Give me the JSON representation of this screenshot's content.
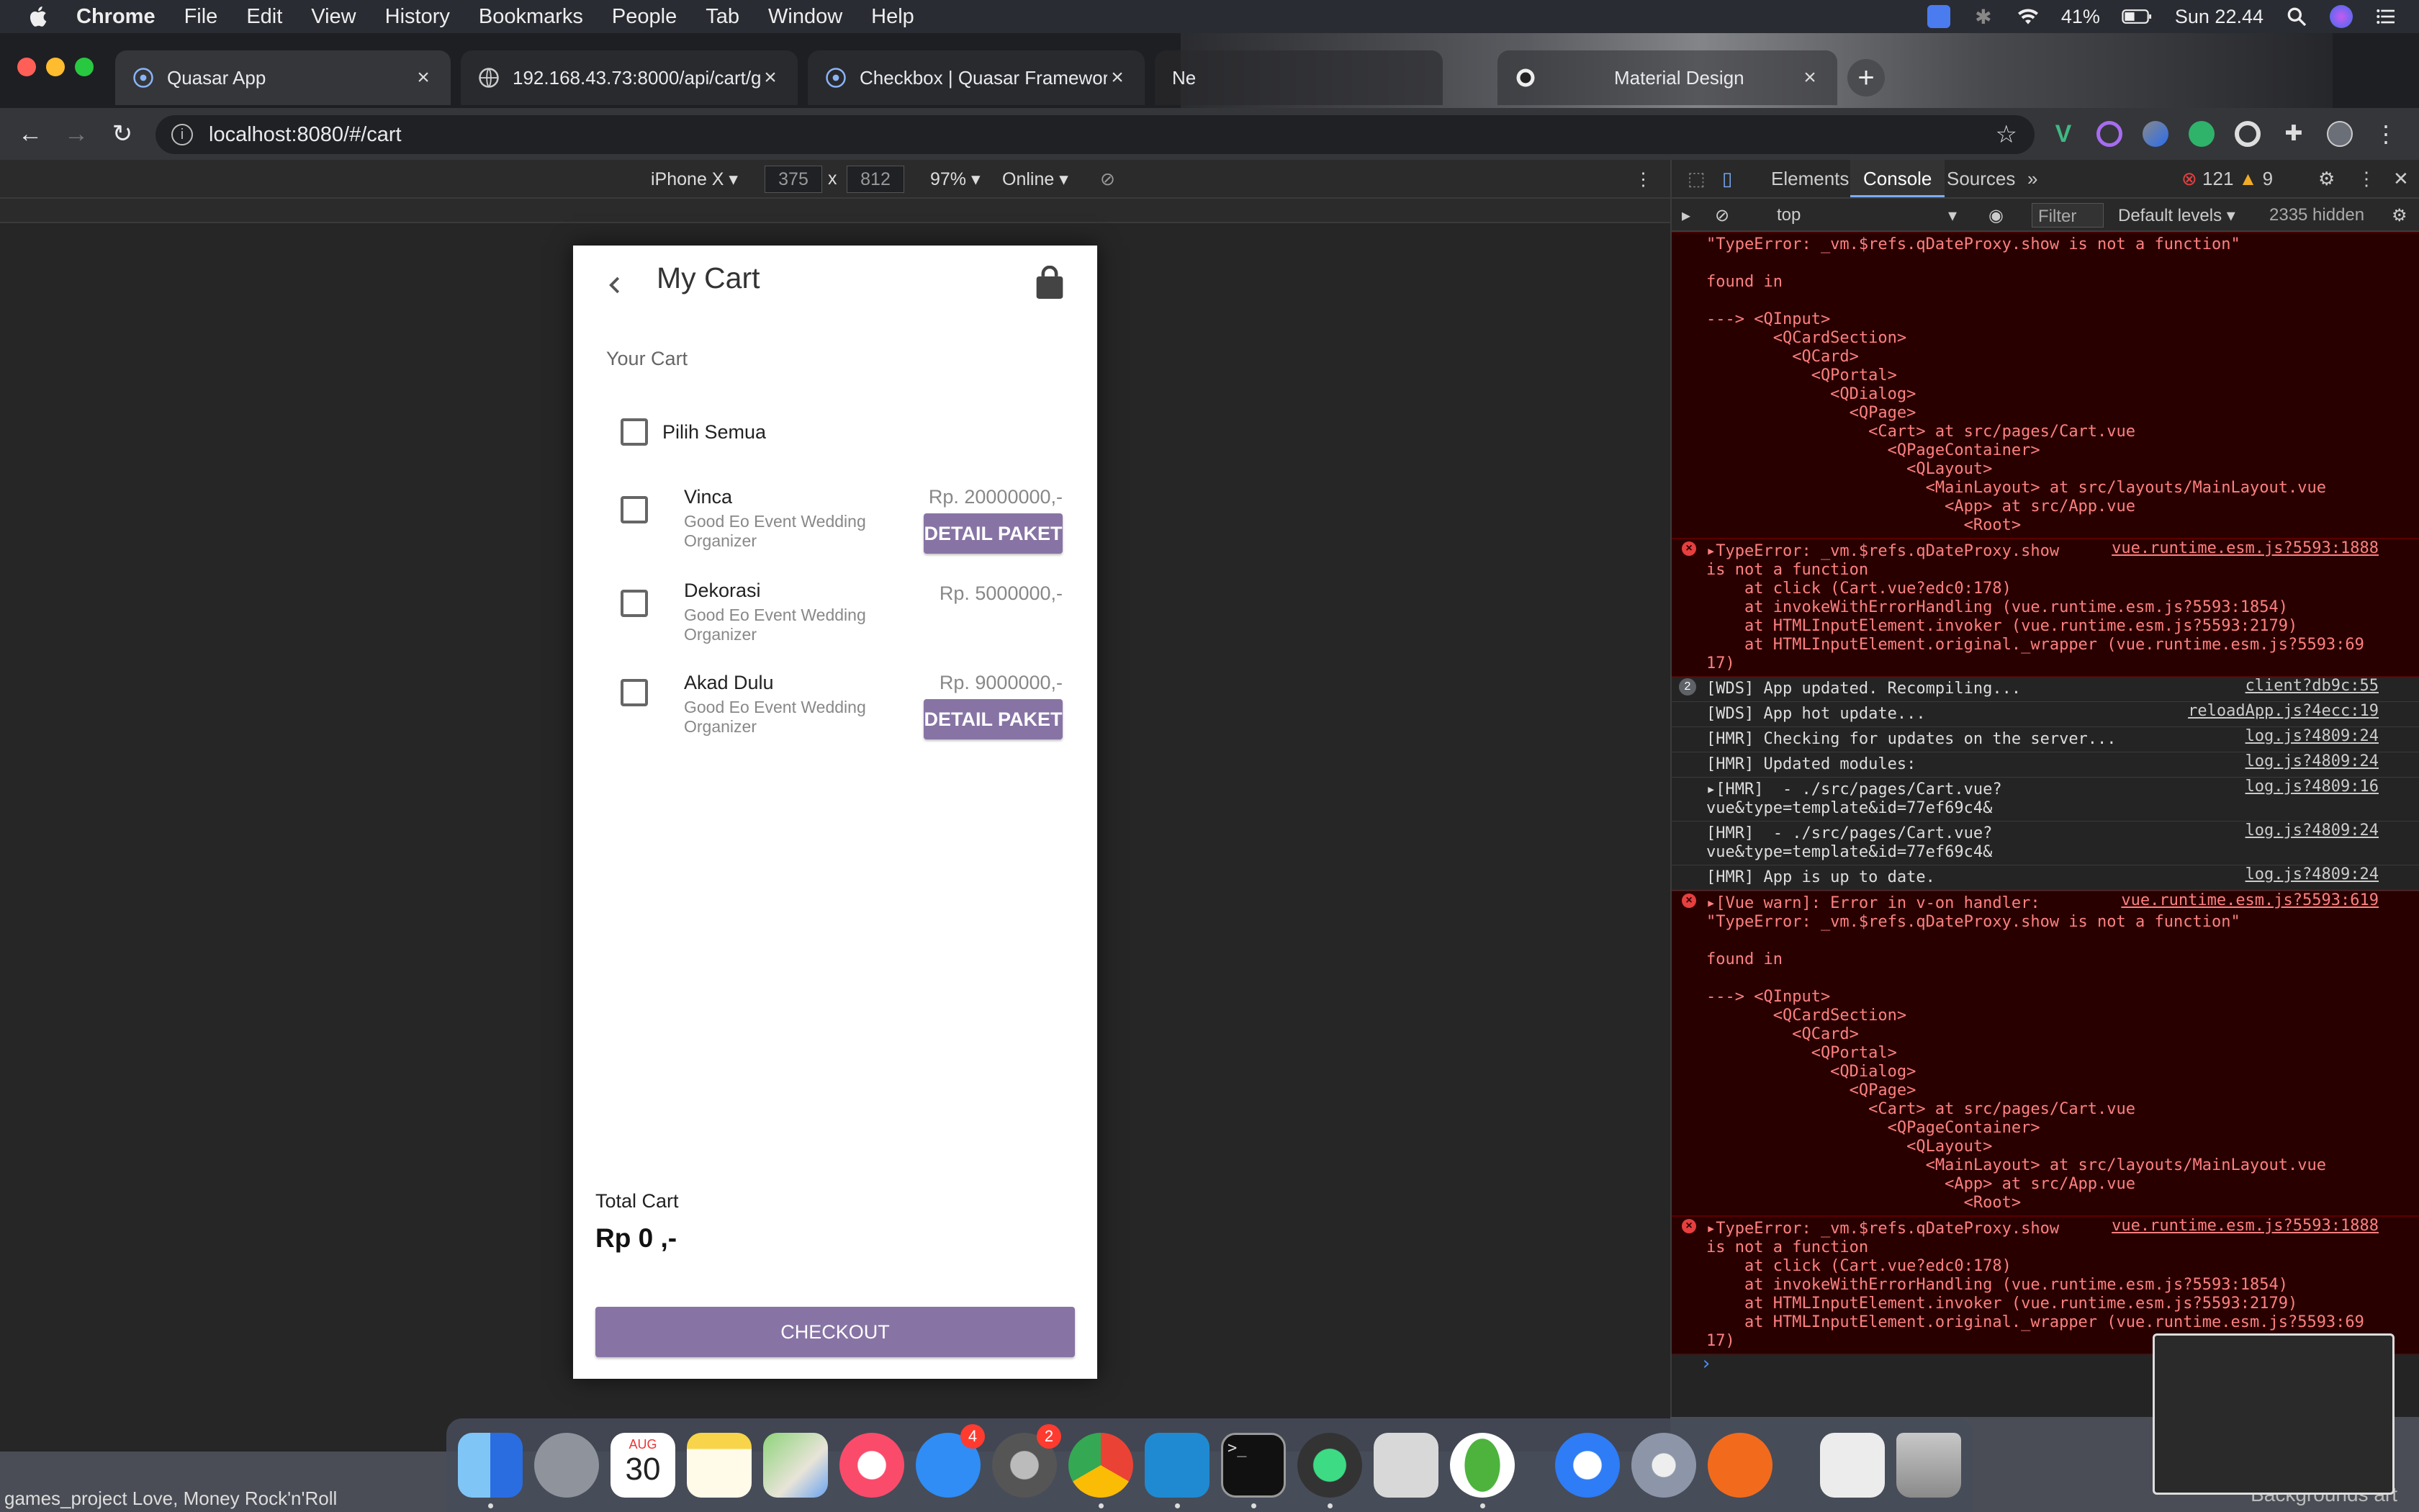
{
  "menubar": {
    "app": "Chrome",
    "items": [
      "File",
      "Edit",
      "View",
      "History",
      "Bookmarks",
      "People",
      "Tab",
      "Window",
      "Help"
    ],
    "battery": "41%",
    "clock": "Sun 22.44"
  },
  "tabs": [
    {
      "title": "Quasar App",
      "icon": "quasar-icon"
    },
    {
      "title": "192.168.43.73:8000/api/cart/g",
      "icon": "globe-icon"
    },
    {
      "title": "Checkbox | Quasar Framework",
      "icon": "quasar-icon"
    },
    {
      "title": "Ne",
      "icon": ""
    },
    {
      "title": "Material Design",
      "icon": "github-icon"
    }
  ],
  "address": {
    "url": "localhost:8080/#/cart"
  },
  "device_toolbar": {
    "device": "iPhone X",
    "width": "375",
    "times": "x",
    "height": "812",
    "zoom": "97%",
    "network": "Online"
  },
  "app": {
    "title": "My Cart",
    "subtitle": "Your Cart",
    "select_all": "Pilih Semua",
    "items": [
      {
        "name": "Vinca",
        "org": "Good Eo Event Wedding Organizer",
        "price": "Rp. 20000000,-",
        "button": "DETAIL PAKET"
      },
      {
        "name": "Dekorasi",
        "org": "Good Eo Event Wedding Organizer",
        "price": "Rp. 5000000,-",
        "button": ""
      },
      {
        "name": "Akad Dulu",
        "org": "Good Eo Event Wedding Organizer",
        "price": "Rp. 9000000,-",
        "button": "DETAIL PAKET"
      }
    ],
    "total_label": "Total Cart",
    "total_value": "Rp 0 ,-",
    "checkout": "CHECKOUT"
  },
  "devtools": {
    "tabs": [
      "Elements",
      "Console",
      "Sources",
      "»"
    ],
    "errors": "121",
    "warnings": "9",
    "context": "top",
    "filter_placeholder": "Filter",
    "levels": "Default levels",
    "hidden": "2335 hidden"
  },
  "console": [
    {
      "kind": "err",
      "icon": false,
      "lines": [
        "\"TypeError: _vm.$refs.qDateProxy.show is not a function\"",
        "",
        "found in",
        "",
        "---> <QInput>",
        "       <QCardSection>",
        "         <QCard>",
        "           <QPortal>",
        "             <QDialog>",
        "               <QPage>",
        "                 <Cart> at src/pages/Cart.vue",
        "                   <QPageContainer>",
        "                     <QLayout>",
        "                       <MainLayout> at src/layouts/MainLayout.vue",
        "                         <App> at src/App.vue",
        "                           <Root>"
      ],
      "src": ""
    },
    {
      "kind": "err",
      "icon": true,
      "lines": [
        "▸TypeError: _vm.$refs.qDateProxy.show",
        "is not a function",
        "    at click (Cart.vue?edc0:178)",
        "    at invokeWithErrorHandling (vue.runtime.esm.js?5593:1854)",
        "    at HTMLInputElement.invoker (vue.runtime.esm.js?5593:2179)",
        "    at HTMLInputElement.original._wrapper (vue.runtime.esm.js?5593:69",
        "17)"
      ],
      "src": "vue.runtime.esm.js?5593:1888"
    },
    {
      "kind": "log",
      "count": "2",
      "lines": [
        "[WDS] App updated. Recompiling..."
      ],
      "src": "client?db9c:55"
    },
    {
      "kind": "log",
      "lines": [
        "[WDS] App hot update..."
      ],
      "src": "reloadApp.js?4ecc:19"
    },
    {
      "kind": "log",
      "lines": [
        "[HMR] Checking for updates on the server..."
      ],
      "src": "log.js?4809:24"
    },
    {
      "kind": "log",
      "lines": [
        "[HMR] Updated modules:"
      ],
      "src": "log.js?4809:24"
    },
    {
      "kind": "log",
      "lines": [
        "▸[HMR]  - ./src/pages/Cart.vue?",
        "vue&type=template&id=77ef69c4&"
      ],
      "src": "log.js?4809:16"
    },
    {
      "kind": "log",
      "lines": [
        "[HMR]  - ./src/pages/Cart.vue?",
        "vue&type=template&id=77ef69c4&"
      ],
      "src": "log.js?4809:24"
    },
    {
      "kind": "log",
      "lines": [
        "[HMR] App is up to date."
      ],
      "src": "log.js?4809:24"
    },
    {
      "kind": "err",
      "icon": true,
      "lines": [
        "▸[Vue warn]: Error in v-on handler:",
        "\"TypeError: _vm.$refs.qDateProxy.show is not a function\"",
        "",
        "found in",
        "",
        "---> <QInput>",
        "       <QCardSection>",
        "         <QCard>",
        "           <QPortal>",
        "             <QDialog>",
        "               <QPage>",
        "                 <Cart> at src/pages/Cart.vue",
        "                   <QPageContainer>",
        "                     <QLayout>",
        "                       <MainLayout> at src/layouts/MainLayout.vue",
        "                         <App> at src/App.vue",
        "                           <Root>"
      ],
      "src": "vue.runtime.esm.js?5593:619"
    },
    {
      "kind": "err",
      "icon": true,
      "lines": [
        "▸TypeError: _vm.$refs.qDateProxy.show",
        "is not a function",
        "    at click (Cart.vue?edc0:178)",
        "    at invokeWithErrorHandling (vue.runtime.esm.js?5593:1854)",
        "    at HTMLInputElement.invoker (vue.runtime.esm.js?5593:2179)",
        "    at HTMLInputElement.original._wrapper (vue.runtime.esm.js?5593:69",
        "17)"
      ],
      "src": "vue.runtime.esm.js?5593:1888"
    }
  ],
  "dock": {
    "apps": [
      "finder",
      "launchpad",
      "calendar",
      "notes",
      "maps",
      "music",
      "app-store",
      "system-preferences",
      "chrome",
      "vscode",
      "terminal",
      "android-studio",
      "screenshot",
      "mongodb",
      "teamviewer",
      "preferences",
      "sketch",
      "preview",
      "trash"
    ],
    "calendar_month": "AUG",
    "calendar_day": "30",
    "app_store_badge": "4",
    "settings_badge": "2"
  },
  "desktop": {
    "left_text": "games_project Love, Money Rock'n'Roll",
    "right_text": "Backgrounds art"
  },
  "colors": {
    "accent": "#8774a5",
    "devtools_error_bg": "#290000"
  }
}
